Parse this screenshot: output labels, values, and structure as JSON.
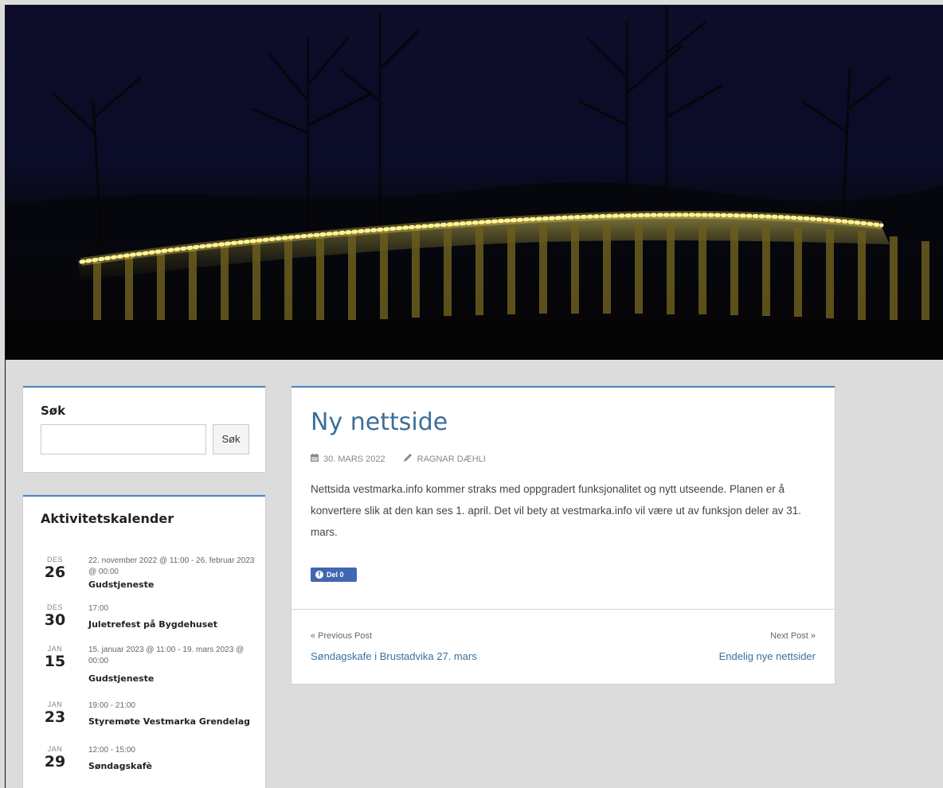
{
  "hero": {
    "image": "night-scene-bridge-with-string-lights"
  },
  "search_widget": {
    "title": "Søk",
    "input_value": "",
    "button_label": "Søk"
  },
  "calendar_widget": {
    "title": "Aktivitetskalender",
    "events": [
      {
        "month": "DES",
        "day": "26",
        "time": "22. november 2022 @ 11:00 - 26. februar 2023 @ 00:00",
        "title": "Gudstjeneste"
      },
      {
        "month": "DES",
        "day": "30",
        "time": "17:00",
        "title": "Juletrefest på Bygdehuset"
      },
      {
        "month": "JAN",
        "day": "15",
        "time": "15. januar 2023 @ 11:00 - 19. mars 2023 @ 00:00",
        "title": "Gudstjeneste"
      },
      {
        "month": "JAN",
        "day": "23",
        "time": "19:00 - 21:00",
        "title": "Styremøte Vestmarka Grendelag"
      },
      {
        "month": "JAN",
        "day": "29",
        "time": "12:00 - 15:00",
        "title": "Søndagskafè"
      }
    ]
  },
  "post": {
    "title": "Ny nettside",
    "date": "30. MARS 2022",
    "author": "RAGNAR DÆHLI",
    "body": "Nettsida vestmarka.info kommer straks med oppgradert funksjonalitet og nytt utseende. Planen er å konvertere slik at den kan ses 1. april. Det vil bety at vestmarka.info vil være ut av funksjon deler av 31. mars.",
    "share_label": "Del 0",
    "prev_label": "« Previous Post",
    "prev_title": "Søndagskafe i Brustadvika 27. mars",
    "next_label": "Next Post »",
    "next_title": "Endelig nye nettsider"
  },
  "colors": {
    "accent": "#4a86c5",
    "link": "#3d6f99",
    "page_bg": "#dcdcdc",
    "facebook": "#4267b2"
  },
  "icons": [
    "calendar-icon",
    "pencil-icon",
    "facebook-icon"
  ]
}
